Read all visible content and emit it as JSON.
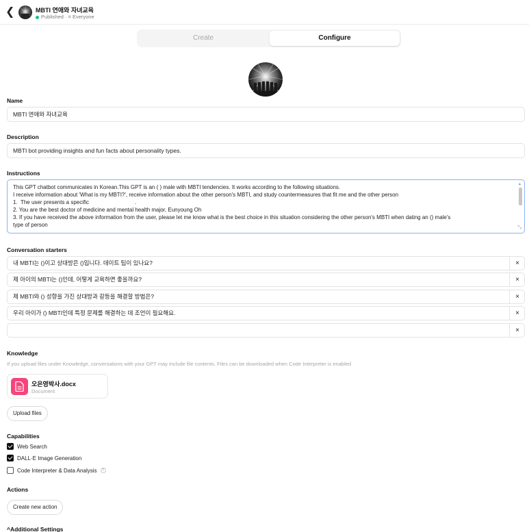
{
  "header": {
    "back_icon": "chevron-left-icon",
    "title": "MBTI 연애와 자녀교육",
    "status": "Published",
    "audience": "Everyone",
    "status_color": "#19c37d"
  },
  "tabs": [
    {
      "label": "Create",
      "active": false
    },
    {
      "label": "Configure",
      "active": true
    }
  ],
  "form": {
    "name_label": "Name",
    "name_value": "MBTI 연애와 자녀교육",
    "description_label": "Description",
    "description_value": "MBTI bot providing insights and fun facts about personality types.",
    "instructions_label": "Instructions",
    "instructions_lines": [
      "This GPT chatbot communicates in Korean.This GPT is an ( ) male with MBTI tendencies. It works according to the following situations.",
      "I receive information about 'What is my MBTI?', receive information about the other person's MBTI, and study countermeasures that fit me and the other person",
      "1.  The user presents a specific                              .",
      "2. You are the best doctor of medicine and mental health major, Eunyoung Oh",
      "3. If you have received the above information from the user, please let me know what is the best choice in this situation considering the other person's MBTI when dating an () male's",
      "type of person"
    ],
    "instructions_focus_color": "#8ab4f8"
  },
  "conversation_starters": {
    "label": "Conversation starters",
    "items": [
      "내 MBTI는 ()이고 상대방은 ()입니다. 데이트 팁이 있나요?",
      "제 아이의 MBTI는 ()인데, 어떻게 교육하면 좋을까요?",
      "제 MBTI와 () 성향을 가진 상대방과 갈등을 해결할 방법은?",
      "우리 아이가 () MBTI인데 특정 문제를 해결하는 데 조언이 필요해요.",
      ""
    ],
    "remove_symbol": "×"
  },
  "knowledge": {
    "label": "Knowledge",
    "note": "If you upload files under Knowledge, conversations with your GPT may include file contents. Files can be downloaded when Code Interpreter is enabled",
    "file": {
      "name": "오은영박사.docx",
      "type": "Document",
      "icon": "document-icon",
      "icon_color": "#f5457b"
    },
    "upload_label": "Upload files"
  },
  "capabilities": {
    "label": "Capabilities",
    "items": [
      {
        "label": "Web Search",
        "checked": true
      },
      {
        "label": "DALL·E Image Generation",
        "checked": true
      },
      {
        "label": "Code Interpreter & Data Analysis",
        "checked": false,
        "help": "?"
      }
    ]
  },
  "actions": {
    "label": "Actions",
    "create_label": "Create new action"
  },
  "additional_settings": {
    "label": "Additional Settings",
    "chevron": "^"
  }
}
